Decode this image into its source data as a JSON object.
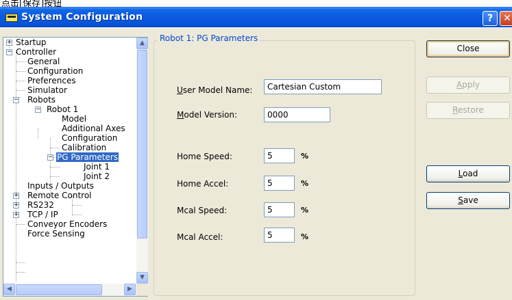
{
  "page_top_text": "点击[保存]按钮",
  "window": {
    "title": "System Configuration",
    "help_glyph": "?",
    "close_glyph": "✕"
  },
  "tree": {
    "items": [
      {
        "label": "Startup",
        "expander": "+"
      },
      {
        "label": "Controller",
        "expander": "−"
      },
      {
        "label": "General"
      },
      {
        "label": "Configuration"
      },
      {
        "label": "Preferences"
      },
      {
        "label": "Simulator"
      },
      {
        "label": "Robots",
        "expander": "−"
      },
      {
        "label": "Robot 1",
        "expander": "−"
      },
      {
        "label": "Model"
      },
      {
        "label": "Additional Axes"
      },
      {
        "label": "Configuration"
      },
      {
        "label": "Calibration"
      },
      {
        "label": "PG Parameters",
        "expander": "−",
        "selected": true
      },
      {
        "label": "Joint 1"
      },
      {
        "label": "Joint 2"
      },
      {
        "label": "Inputs / Outputs"
      },
      {
        "label": "Remote Control",
        "expander": "+"
      },
      {
        "label": "RS232",
        "expander": "+"
      },
      {
        "label": "TCP / IP",
        "expander": "+"
      },
      {
        "label": "Conveyor Encoders"
      },
      {
        "label": "Force Sensing"
      }
    ],
    "scroll_up": "▲",
    "scroll_down": "▼",
    "scroll_left": "◀",
    "scroll_right": "▶"
  },
  "group": {
    "label": "Robot 1: PG Parameters"
  },
  "fields": {
    "user_model_name": {
      "mnemonic": "U",
      "rest": "ser Model Name:",
      "value": "Cartesian Custom"
    },
    "model_version": {
      "mnemonic": "M",
      "rest": "odel Version:",
      "value": "0000"
    },
    "home_speed": {
      "label": "Home Speed:",
      "value": "5",
      "unit": "%"
    },
    "home_accel": {
      "label": "Home Accel:",
      "value": "5",
      "unit": "%"
    },
    "mcal_speed": {
      "label": "Mcal Speed:",
      "value": "5",
      "unit": "%"
    },
    "mcal_accel": {
      "label": "Mcal Accel:",
      "value": "5",
      "unit": "%"
    }
  },
  "buttons": {
    "close": "Close",
    "apply_mn": "A",
    "apply_rest": "pply",
    "restore_mn": "R",
    "restore_rest": "estore",
    "load_mn": "L",
    "load_rest": "oad",
    "save_mn": "S",
    "save_rest": "ave"
  },
  "colors": {
    "titlebar": "#0a5ae0",
    "selection": "#316ac5",
    "group_label": "#0046d5",
    "dialog_bg": "#ece9d8"
  }
}
